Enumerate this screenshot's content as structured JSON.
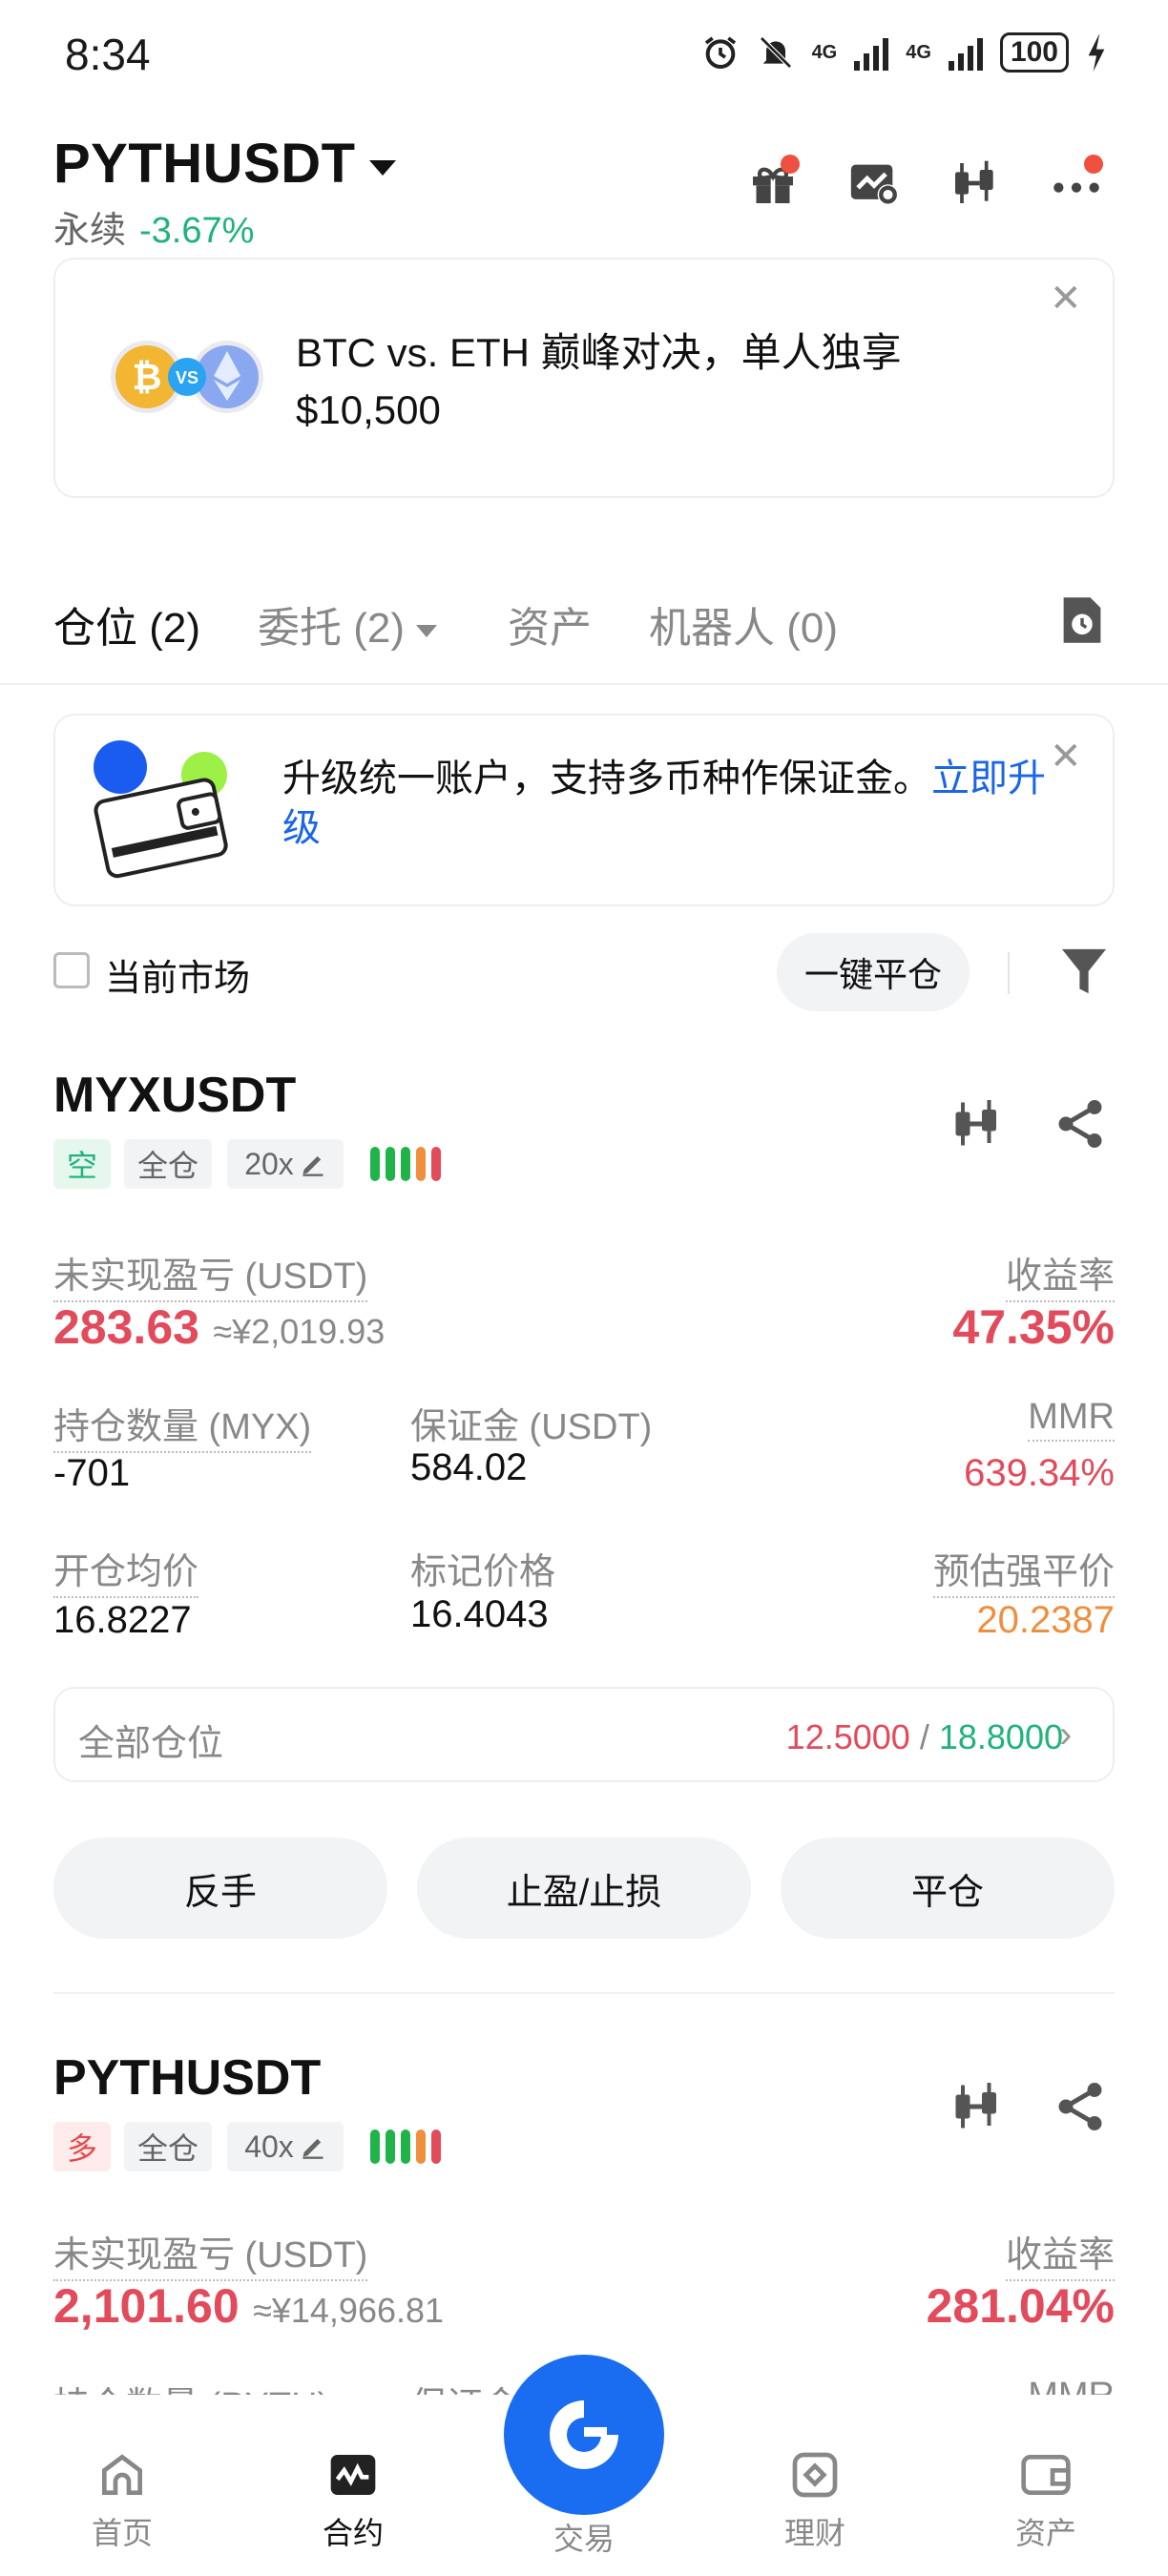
{
  "status_bar": {
    "time": "8:34",
    "net1": "4G",
    "net2": "4G",
    "battery": "100"
  },
  "header": {
    "pair": "PYTHUSDT",
    "type": "永续",
    "change": "-3.67%"
  },
  "promo": {
    "line1": "BTC vs. ETH 巅峰对决，单人独享",
    "line2": "$10,500",
    "badge": "VS"
  },
  "tabs": [
    {
      "label": "仓位 (2)"
    },
    {
      "label": "委托 (2)"
    },
    {
      "label": "资产"
    },
    {
      "label": "机器人 (0)"
    }
  ],
  "upgrade": {
    "text": "升级统一账户，支持多币种作保证金。",
    "link": "立即升级"
  },
  "filter": {
    "current_market": "当前市场",
    "close_all": "一键平仓"
  },
  "positions": [
    {
      "symbol": "MYXUSDT",
      "side": "空",
      "margin_mode": "全仓",
      "leverage": "20x",
      "unrealized_label": "未实现盈亏 (USDT)",
      "unrealized": "283.63",
      "unrealized_cny": "≈¥2,019.93",
      "roe_label": "收益率",
      "roe": "47.35%",
      "qty_label": "持仓数量 (MYX)",
      "qty": "-701",
      "margin_label": "保证金 (USDT)",
      "margin": "584.02",
      "mmr_label": "MMR",
      "mmr": "639.34%",
      "entry_label": "开仓均价",
      "entry": "16.8227",
      "mark_label": "标记价格",
      "mark": "16.4043",
      "liq_label": "预估强平价",
      "liq": "20.2387",
      "all_positions_label": "全部仓位",
      "tp": "12.5000",
      "sl": "18.8000",
      "sep": "/",
      "actions": [
        "反手",
        "止盈/止损",
        "平仓"
      ]
    },
    {
      "symbol": "PYTHUSDT",
      "side": "多",
      "margin_mode": "全仓",
      "leverage": "40x",
      "unrealized_label": "未实现盈亏 (USDT)",
      "unrealized": "2,101.60",
      "unrealized_cny": "≈¥14,966.81",
      "roe_label": "收益率",
      "roe": "281.04%",
      "qty_label": "持仓数量 (PYTH)",
      "margin_label": "保证金",
      "mmr_label": "MMR"
    }
  ],
  "bottom_nav": [
    {
      "label": "首页"
    },
    {
      "label": "合约"
    },
    {
      "label": "交易"
    },
    {
      "label": "理财"
    },
    {
      "label": "资产"
    }
  ],
  "colors": {
    "accent": "#1a6cf0",
    "profit": "#e24b5b",
    "green": "#1fb37a",
    "orange": "#ef8f3d"
  }
}
